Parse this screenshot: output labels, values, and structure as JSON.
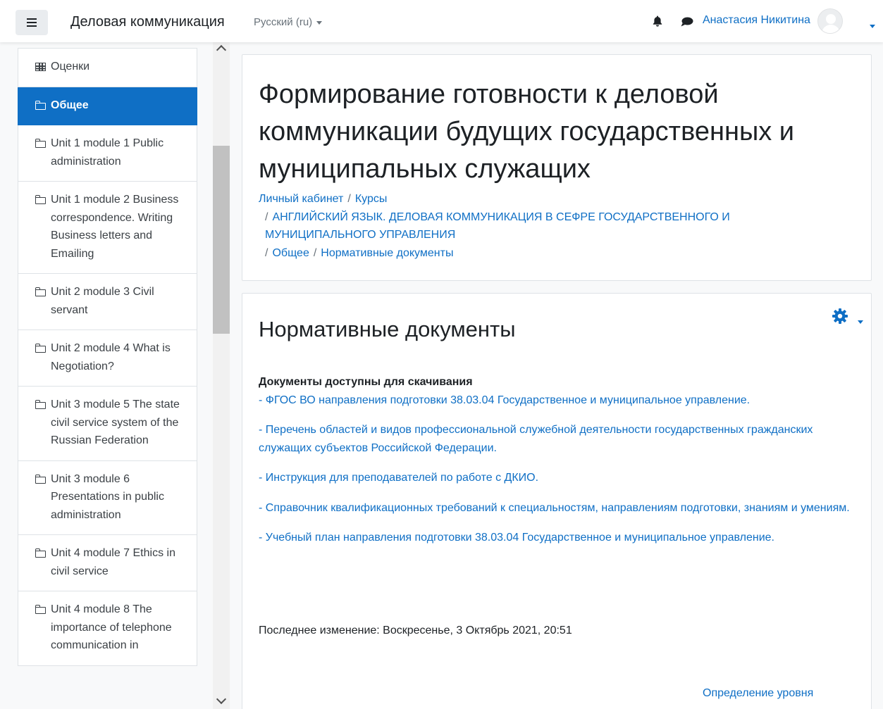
{
  "navbar": {
    "brand": "Деловая коммуникация",
    "language": "Русский (ru)",
    "user_name": "Анастасия Никитина"
  },
  "sidebar": {
    "items": [
      {
        "label": "Оценки",
        "icon": "table-icon"
      },
      {
        "label": "Общее",
        "icon": "folder-icon",
        "active": true
      },
      {
        "label": "Unit 1 module 1 Public administration",
        "icon": "folder-icon"
      },
      {
        "label": "Unit 1 module 2 Business correspondence. Writing Business letters and Emailing",
        "icon": "folder-icon"
      },
      {
        "label": "Unit 2 module 3 Civil servant",
        "icon": "folder-icon"
      },
      {
        "label": "Unit 2 module 4 What is Negotiation?",
        "icon": "folder-icon"
      },
      {
        "label": "Unit 3 module 5 The state civil service system of the Russian Federation",
        "icon": "folder-icon"
      },
      {
        "label": "Unit 3 module 6 Presentations in public administration",
        "icon": "folder-icon"
      },
      {
        "label": "Unit 4 module 7 Ethics in civil service",
        "icon": "folder-icon"
      },
      {
        "label": "Unit 4 module 8 The importance of telephone communication in",
        "icon": "folder-icon"
      }
    ]
  },
  "header": {
    "title": "Формирование готовности к деловой коммуникации будущих государственных и муниципальных служащих",
    "breadcrumb": {
      "dashboard": "Личный кабинет",
      "courses": "Курсы",
      "course": "АНГЛИЙСКИЙ ЯЗЫК. ДЕЛОВАЯ КОММУНИКАЦИЯ В СЕФРЕ ГОСУДАРСТВЕННОГО И МУНИЦИПАЛЬНОГО УПРАВЛЕНИЯ",
      "section": "Общее",
      "page": "Нормативные документы"
    }
  },
  "content": {
    "title": "Нормативные документы",
    "docs_heading": "Документы доступны для скачивания",
    "docs": [
      "- ФГОС ВО направления подготовки 38.03.04 Государственное и муниципальное управление.",
      "- Перечень областей и видов профессиональной служебной деятельности государственных гражданских служащих субъектов Российской Федерации.",
      "- Инструкция для преподавателей по работе с ДКИО.",
      "- Справочник квалификационных требований к специальностям, направлениям подготовки, знаниям и умениям.",
      "- Учебный план направления подготовки 38.03.04 Государственное и муниципальное управление."
    ],
    "last_modified": "Последнее изменение: Воскресенье, 3 Октябрь 2021, 20:51",
    "next_link": "Определение уровня"
  },
  "colors": {
    "accent": "#0f6fc5",
    "text": "#1d2125",
    "border": "#dee2e6"
  }
}
